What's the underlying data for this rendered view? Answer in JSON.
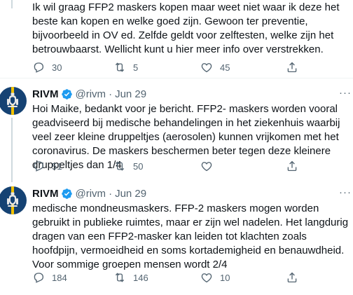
{
  "tweets": [
    {
      "text": "Ik wil graag FFP2 maskers kopen maar weet niet waar ik deze het beste kan kopen en welke goed zijn.  Gewoon ter preventie, bijvoorbeeld in OV ed. Zelfde geldt voor zelftesten, welke zijn het betrouwbaarst. Wellicht kunt u hier meer info over verstrekken.",
      "reply_count": "30",
      "retweet_count": "5",
      "like_count": "45"
    },
    {
      "name": "RIVM",
      "handle": "@rivm",
      "dot": "·",
      "date": "Jun 29",
      "more": "···",
      "text": "Hoi Maike, bedankt voor je bericht. FFP2- maskers worden vooral geadviseerd bij medische behandelingen in het ziekenhuis waarbij veel zeer kleine druppeltjes (aerosolen) kunnen vrijkomen met het coronavirus. De maskers beschermen beter tegen deze kleinere druppeltjes dan 1/4",
      "reply_count": "51",
      "retweet_count": "50",
      "like_count": ""
    },
    {
      "name": "RIVM",
      "handle": "@rivm",
      "dot": "·",
      "date": "Jun 29",
      "more": "···",
      "text": "medische mondneusmaskers. FFP-2 maskers mogen worden gebruikt in publieke ruimtes, maar er zijn wel nadelen. Het langdurig dragen van een FFP2-masker kan leiden tot klachten zoals hoofdpijn, vermoeidheid en soms kortademigheid en benauwdheid. Voor sommige groepen mensen wordt 2/4",
      "reply_count": "184",
      "retweet_count": "146",
      "like_count": "10"
    }
  ],
  "colors": {
    "text": "#0f1419",
    "muted": "#536471",
    "verified": "#1d9bf0",
    "thread_line": "#cfd9de",
    "avatar_bg": "#154273"
  },
  "icons": [
    "reply-icon",
    "retweet-icon",
    "like-icon",
    "share-icon",
    "verified-badge-icon",
    "rivm-logo"
  ]
}
